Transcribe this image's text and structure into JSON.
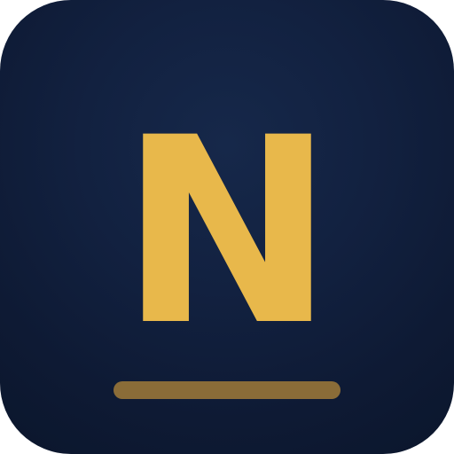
{
  "app_icon": {
    "letter": "N",
    "colors": {
      "background_center": "#16284a",
      "background_edge": "#0b162c",
      "letter": "#e8b84b",
      "underline": "#8a6c38"
    }
  }
}
